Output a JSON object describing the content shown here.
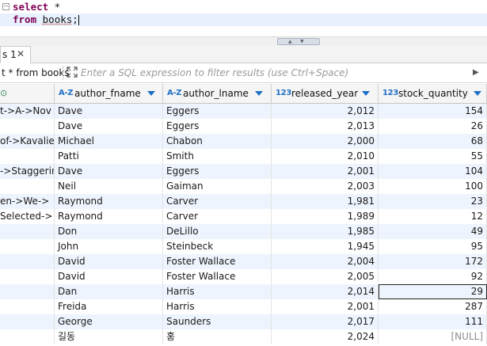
{
  "editor": {
    "line1": [
      "select",
      " *"
    ],
    "line2": [
      "from",
      "books",
      ";"
    ]
  },
  "tab": {
    "label": "s 1",
    "close": "✕"
  },
  "filter": {
    "source_label": "t * from books",
    "placeholder": "Enter a SQL expression to filter results (use Ctrl+Space)"
  },
  "columns": [
    {
      "name": "author_fname",
      "type": "A-Z"
    },
    {
      "name": "author_lname",
      "type": "A-Z"
    },
    {
      "name": "released_year",
      "type": "123"
    },
    {
      "name": "stock_quantity",
      "type": "123"
    }
  ],
  "rows": [
    {
      "title": "t->A->Nov",
      "fname": "Dave",
      "lname": "Eggers",
      "year": "2,012",
      "qty": "154"
    },
    {
      "title": "",
      "fname": "Dave",
      "lname": "Eggers",
      "year": "2,013",
      "qty": "26"
    },
    {
      "title": "of->Kavalie",
      "fname": "Michael",
      "lname": "Chabon",
      "year": "2,000",
      "qty": "68"
    },
    {
      "title": "",
      "fname": "Patti",
      "lname": "Smith",
      "year": "2,010",
      "qty": "55"
    },
    {
      "title": "->Staggering",
      "fname": "Dave",
      "lname": "Eggers",
      "year": "2,001",
      "qty": "104"
    },
    {
      "title": "",
      "fname": "Neil",
      "lname": "Gaiman",
      "year": "2,003",
      "qty": "100"
    },
    {
      "title": "en->We->",
      "fname": "Raymond",
      "lname": "Carver",
      "year": "1,981",
      "qty": "23"
    },
    {
      "title": "Selected->",
      "fname": "Raymond",
      "lname": "Carver",
      "year": "1,989",
      "qty": "12"
    },
    {
      "title": "",
      "fname": "Don",
      "lname": "DeLillo",
      "year": "1,985",
      "qty": "49"
    },
    {
      "title": "",
      "fname": "John",
      "lname": "Steinbeck",
      "year": "1,945",
      "qty": "95"
    },
    {
      "title": "",
      "fname": "David",
      "lname": "Foster Wallace",
      "year": "2,004",
      "qty": "172"
    },
    {
      "title": "",
      "fname": "David",
      "lname": "Foster Wallace",
      "year": "2,005",
      "qty": "92"
    },
    {
      "title": "",
      "fname": "Dan",
      "lname": "Harris",
      "year": "2,014",
      "qty": "29"
    },
    {
      "title": "",
      "fname": "Freida",
      "lname": "Harris",
      "year": "2,001",
      "qty": "287"
    },
    {
      "title": "",
      "fname": "George",
      "lname": "Saunders",
      "year": "2,017",
      "qty": "111"
    },
    {
      "title": "",
      "fname": "길동",
      "lname": "홍",
      "year": "2,024",
      "qty": "[NULL]"
    }
  ],
  "colors": {
    "accent": "#1f6fc4",
    "row_alt": "#eef4fd",
    "keyword": "#7f0055"
  }
}
